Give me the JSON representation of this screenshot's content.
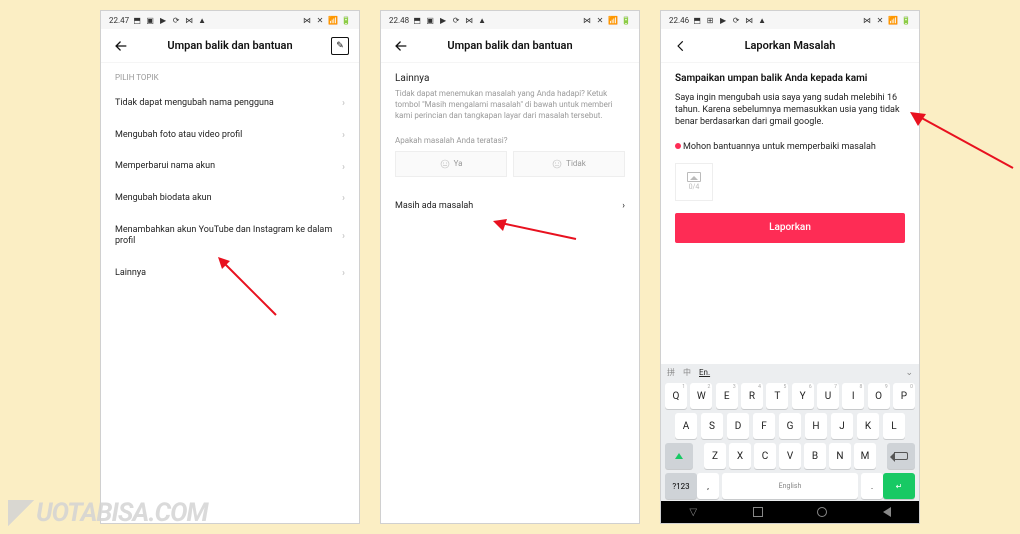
{
  "watermark": "UOTABISA.COM",
  "status": {
    "left": [
      "⬒",
      "▣",
      "▶",
      "⟳",
      "⋈",
      "▲"
    ],
    "right": [
      "⋈",
      "✕",
      "📶",
      "🔋"
    ]
  },
  "phone1": {
    "time": "22.47",
    "header": {
      "title": "Umpan balik dan bantuan"
    },
    "section": "PILIH TOPIK",
    "rows": [
      "Tidak dapat mengubah nama pengguna",
      "Mengubah foto atau video profil",
      "Memperbarui nama akun",
      "Mengubah biodata akun",
      "Menambahkan akun YouTube dan Instagram ke dalam profil",
      "Lainnya"
    ]
  },
  "phone2": {
    "time": "22.48",
    "header": {
      "title": "Umpan balik dan bantuan"
    },
    "heading": "Lainnya",
    "desc": "Tidak dapat menemukan masalah yang Anda hadapi? Ketuk tombol \"Masih mengalami masalah\" di bawah untuk memberi kami perincian dan tangkapan layar dari masalah tersebut.",
    "ask": "Apakah masalah Anda teratasi?",
    "yes": "Ya",
    "no": "Tidak",
    "still": "Masih ada masalah"
  },
  "phone3": {
    "time": "22.46",
    "header": {
      "title": "Laporkan Masalah"
    },
    "heading": "Sampaikan umpan balik Anda kepada kami",
    "text1": "Saya ingin mengubah usia saya yang sudah melebihi 16 tahun. Karena sebelumnya memasukkan usia yang tidak benar berdasarkan dari gmail google.",
    "text2": "Mohon bantuannya untuk memperbaiki masalah",
    "upload": "0/4",
    "report": "Laporkan",
    "keyboard": {
      "langs": [
        "拼",
        "中"
      ],
      "lang_sel": "En.",
      "space": "English",
      "sym": "?123",
      "row1": [
        [
          "Q",
          "1"
        ],
        [
          "W",
          "2"
        ],
        [
          "E",
          "3"
        ],
        [
          "R",
          "4"
        ],
        [
          "T",
          "5"
        ],
        [
          "Y",
          "6"
        ],
        [
          "U",
          "7"
        ],
        [
          "I",
          "8"
        ],
        [
          "O",
          "9"
        ],
        [
          "P",
          "0"
        ]
      ],
      "row2": [
        "A",
        "S",
        "D",
        "F",
        "G",
        "H",
        "J",
        "K",
        "L"
      ],
      "row3": [
        "Z",
        "X",
        "C",
        "V",
        "B",
        "N",
        "M"
      ]
    }
  }
}
